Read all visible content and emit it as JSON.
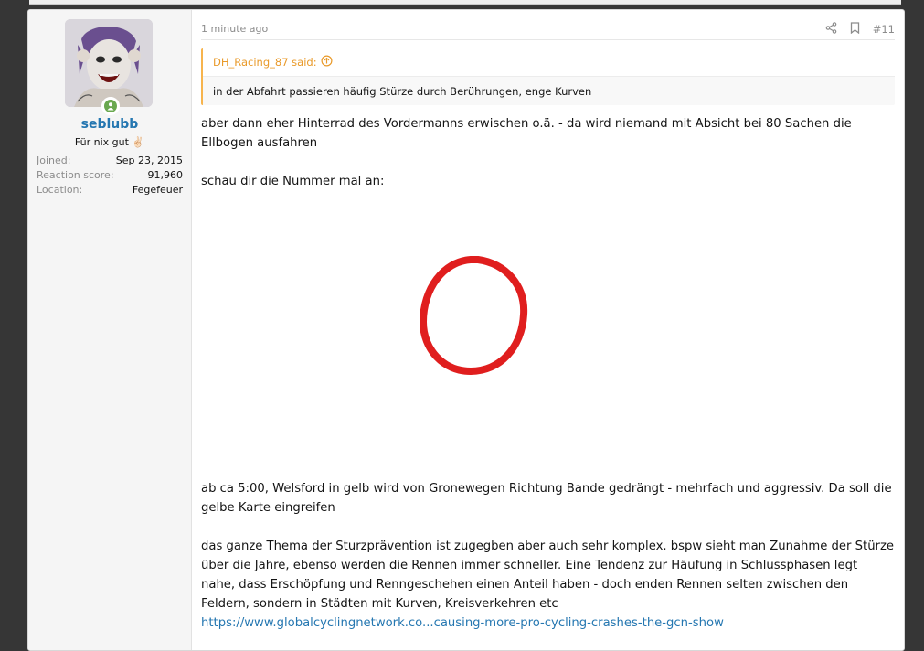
{
  "post": {
    "user": {
      "name": "seblubb",
      "title": "Für nix gut",
      "title_emoji": "✌🏻",
      "stats": [
        {
          "label": "Joined:",
          "value": "Sep 23, 2015"
        },
        {
          "label": "Reaction score:",
          "value": "91,960"
        },
        {
          "label": "Location:",
          "value": "Fegefeuer"
        }
      ]
    },
    "time": "1 minute ago",
    "number": "#11",
    "quote": {
      "author": "DH_Racing_87 said:",
      "text": "in der Abfahrt passieren häufig Stürze durch Berührungen, enge Kurven"
    },
    "body": {
      "p1": "aber dann eher Hinterrad des Vordermanns erwischen o.ä. - da wird niemand mit Absicht bei 80 Sachen die Ellbogen ausfahren",
      "p2": "schau dir die Nummer mal an:",
      "p3": "ab ca 5:00, Welsford in gelb wird von Gronewegen Richtung Bande gedrängt - mehrfach und aggressiv. Da soll die gelbe Karte eingreifen",
      "p4": "das ganze Thema der Sturzprävention ist zugegben aber auch sehr komplex. bspw sieht man Zunahme der Stürze über die Jahre, ebenso werden die Rennen immer schneller. Eine Tendenz zur Häufung in Schlussphasen legt nahe, dass Erschöpfung und Renngeschehen einen Anteil haben - doch enden Rennen selten zwischen den Feldern, sondern in Städten mit Kurven, Kreisverkehren etc",
      "link": "https://www.globalcyclingnetwork.co...causing-more-pro-cycling-crashes-the-gcn-show"
    },
    "colors": {
      "username": "#2577b1",
      "quote_accent": "#f7b44d",
      "circle": "#e01e1e",
      "online": "#6aa84f"
    },
    "icons": [
      "share-icon",
      "bookmark-icon",
      "arrow-up-circle-icon",
      "online-person-icon"
    ]
  }
}
